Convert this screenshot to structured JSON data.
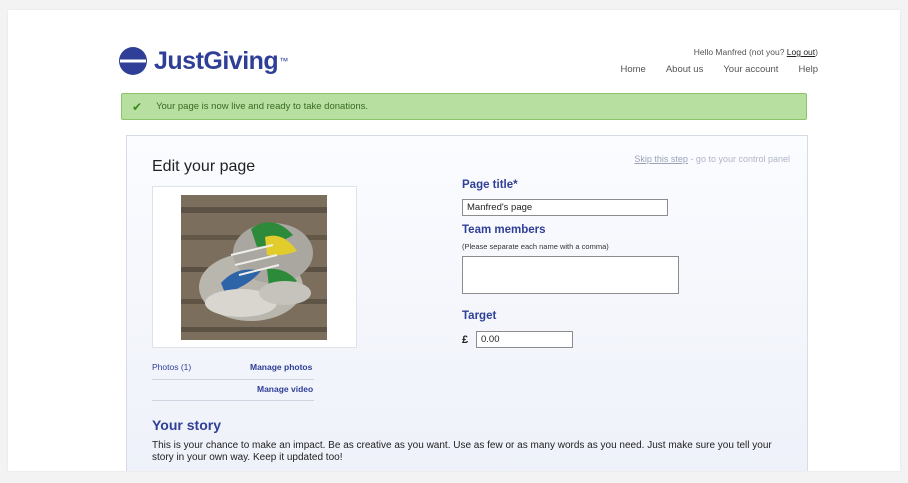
{
  "brand": {
    "name": "JustGiving",
    "trademark": "™",
    "color": "#2f3f97"
  },
  "header": {
    "greeting": "Hello Manfred (not you? ",
    "logout_label": "Log out",
    "greeting_end": ")",
    "nav": [
      "Home",
      "About us",
      "Your account",
      "Help"
    ]
  },
  "alert": {
    "icon": "check-icon",
    "message": "Your page is now live and ready to take donations.",
    "color": "#b7df9f"
  },
  "edit": {
    "title": "Edit your page",
    "skip_link": "Skip this step",
    "skip_rest": " - go to your control panel",
    "photos_count": "Photos (1)",
    "manage_photos": "Manage photos",
    "manage_video": "Manage video"
  },
  "form": {
    "page_title_label": "Page title*",
    "page_title_value": "Manfred's page",
    "team_label": "Team members",
    "team_hint": "(Please separate each name with a comma)",
    "team_value": "",
    "target_label": "Target",
    "currency": "£",
    "target_value": "0.00"
  },
  "story": {
    "title": "Your story",
    "text": "This is your chance to make an impact. Be as creative as you want. Use as few or as many words as you need. Just make sure you tell your story in your own way. Keep it updated too!"
  }
}
